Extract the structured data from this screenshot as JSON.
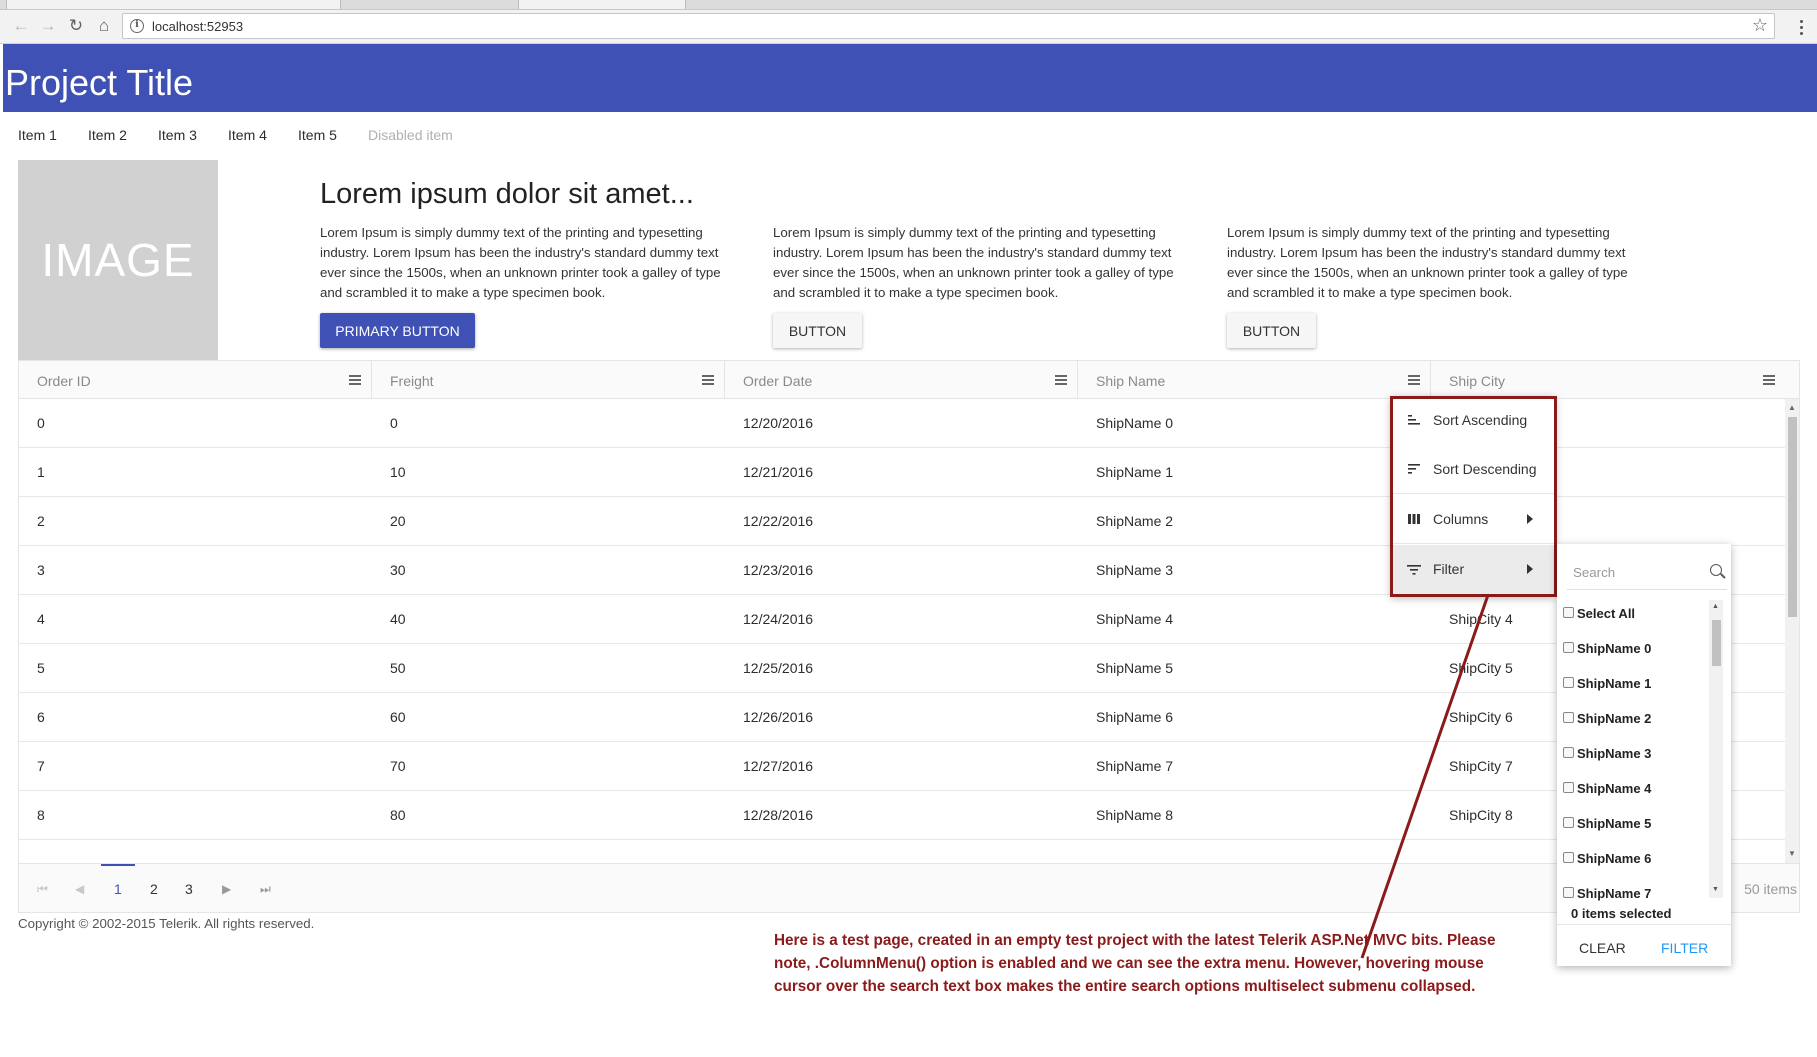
{
  "browser": {
    "url": "localhost:52953",
    "icons": [
      "back-icon",
      "forward-icon",
      "reload-icon",
      "home-icon",
      "info-icon",
      "star-icon",
      "kebab-menu-icon"
    ]
  },
  "header": {
    "title": "Project Title",
    "color": "#3f51b5"
  },
  "menu": {
    "items": [
      "Item 1",
      "Item 2",
      "Item 3",
      "Item 4",
      "Item 5"
    ],
    "disabled_item": "Disabled item"
  },
  "hero": {
    "image_label": "IMAGE",
    "heading": "Lorem ipsum dolor sit amet...",
    "paragraphs": [
      "Lorem Ipsum is simply dummy text of the printing and typesetting industry. Lorem Ipsum has been the industry's standard dummy text ever since the 1500s, when an unknown printer took a galley of type and scrambled it to make a type specimen book.",
      "Lorem Ipsum is simply dummy text of the printing and typesetting industry. Lorem Ipsum has been the industry's standard dummy text ever since the 1500s, when an unknown printer took a galley of type and scrambled it to make a type specimen book.",
      "Lorem Ipsum is simply dummy text of the printing and typesetting industry. Lorem Ipsum has been the industry's standard dummy text ever since the 1500s, when an unknown printer took a galley of type and scrambled it to make a type specimen book."
    ],
    "primary_button": "PRIMARY BUTTON",
    "button": "BUTTON"
  },
  "grid": {
    "columns": [
      "Order ID",
      "Freight",
      "Order Date",
      "Ship Name",
      "Ship City"
    ],
    "rows": [
      [
        "0",
        "0",
        "12/20/2016",
        "ShipName 0",
        ""
      ],
      [
        "1",
        "10",
        "12/21/2016",
        "ShipName 1",
        ""
      ],
      [
        "2",
        "20",
        "12/22/2016",
        "ShipName 2",
        ""
      ],
      [
        "3",
        "30",
        "12/23/2016",
        "ShipName 3",
        ""
      ],
      [
        "4",
        "40",
        "12/24/2016",
        "ShipName 4",
        "ShipCity 4"
      ],
      [
        "5",
        "50",
        "12/25/2016",
        "ShipName 5",
        "ShipCity 5"
      ],
      [
        "6",
        "60",
        "12/26/2016",
        "ShipName 6",
        "ShipCity 6"
      ],
      [
        "7",
        "70",
        "12/27/2016",
        "ShipName 7",
        "ShipCity 7"
      ],
      [
        "8",
        "80",
        "12/28/2016",
        "ShipName 8",
        "ShipCity 8"
      ]
    ],
    "pager": {
      "pages": [
        "1",
        "2",
        "3"
      ],
      "current_page": "1",
      "info": "50 items"
    }
  },
  "column_menu": {
    "items": [
      "Sort Ascending",
      "Sort Descending",
      "Columns",
      "Filter"
    ],
    "hovered": "Filter",
    "highlight_color": "#8b1a1a"
  },
  "filter_menu": {
    "search_placeholder": "Search",
    "options": [
      "Select All",
      "ShipName 0",
      "ShipName 1",
      "ShipName 2",
      "ShipName 3",
      "ShipName 4",
      "ShipName 5",
      "ShipName 6",
      "ShipName 7"
    ],
    "selected_count": "0 items selected",
    "clear": "CLEAR",
    "filter": "FILTER"
  },
  "footer": {
    "copyright": "Copyright © 2002-2015 Telerik. All rights reserved."
  },
  "annotation": {
    "text": "Here is a test page, created in an empty test project with the latest Telerik ASP.Net MVC bits. Please note, .ColumnMenu() option is enabled and we can see the extra menu. However, hovering mouse cursor over the search text box makes the entire search options multiselect submenu collapsed.",
    "color": "#8b1a1a"
  }
}
